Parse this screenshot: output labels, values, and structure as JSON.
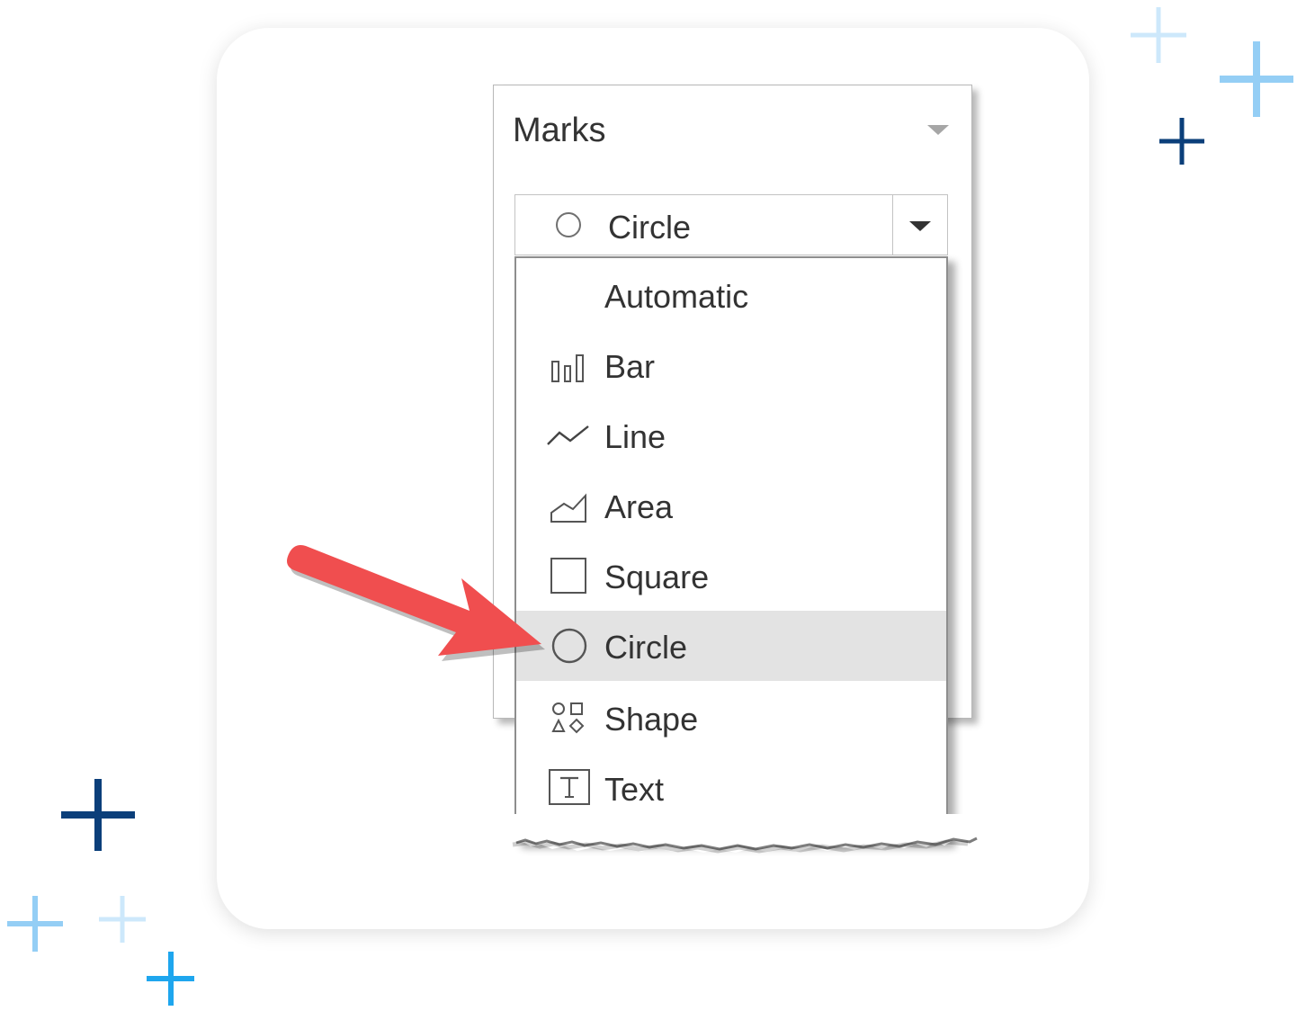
{
  "panel": {
    "title": "Marks",
    "selected_value": "Circle",
    "options": [
      {
        "label": "Automatic",
        "icon": "none"
      },
      {
        "label": "Bar",
        "icon": "bar-icon"
      },
      {
        "label": "Line",
        "icon": "line-icon"
      },
      {
        "label": "Area",
        "icon": "area-icon"
      },
      {
        "label": "Square",
        "icon": "square-icon"
      },
      {
        "label": "Circle",
        "icon": "circle-icon",
        "selected": true
      },
      {
        "label": "Shape",
        "icon": "shape-icon"
      },
      {
        "label": "Text",
        "icon": "text-icon"
      }
    ]
  },
  "colors": {
    "arrow": "#f04e4f",
    "selected_row": "#e3e3e3",
    "dark_plus": "#0b3f7a",
    "mid_plus": "#1ea6ee",
    "light_plus": "#94cef5",
    "pale_plus": "#cde8fb"
  }
}
